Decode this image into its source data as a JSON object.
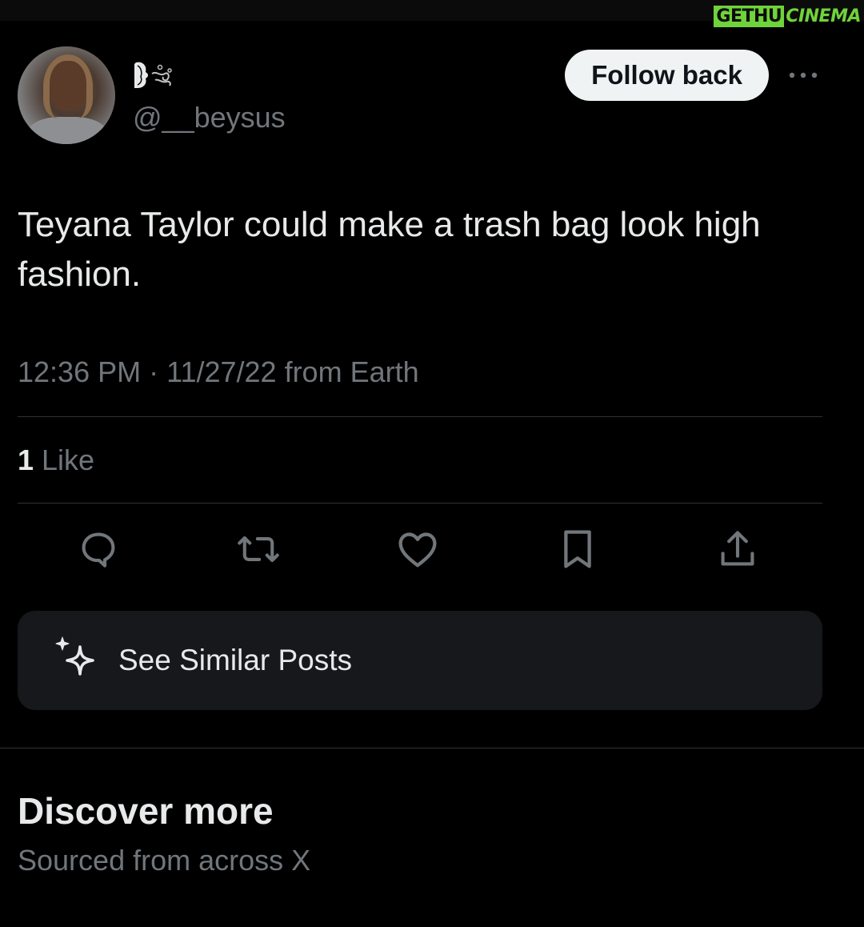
{
  "watermark": {
    "part1": "GETHU",
    "part2": "CINEMA"
  },
  "author": {
    "handle": "@__beysus",
    "display_name_icon": "emoji-silhouette-wind-icon"
  },
  "follow_button": {
    "label": "Follow back"
  },
  "more_icon": "more-dots-icon",
  "post": {
    "text": "Teyana Taylor could make a trash bag look high fashion.",
    "time": "12:36 PM",
    "separator": " · ",
    "date": "11/27/22",
    "source": " from Earth"
  },
  "stats": {
    "likes_count": "1",
    "likes_label": " Like"
  },
  "actions": [
    {
      "name": "reply-icon"
    },
    {
      "name": "repost-icon"
    },
    {
      "name": "like-icon"
    },
    {
      "name": "bookmark-icon"
    },
    {
      "name": "share-icon"
    }
  ],
  "similar": {
    "label": "See Similar Posts",
    "icon": "sparkle-icon"
  },
  "discover": {
    "title": "Discover more",
    "subtitle": "Sourced from across X"
  },
  "colors": {
    "background": "#000000",
    "text": "#e7e9ea",
    "muted": "#71767b",
    "divider": "#2f3336",
    "card": "#16181c",
    "button": "#eff3f4"
  }
}
